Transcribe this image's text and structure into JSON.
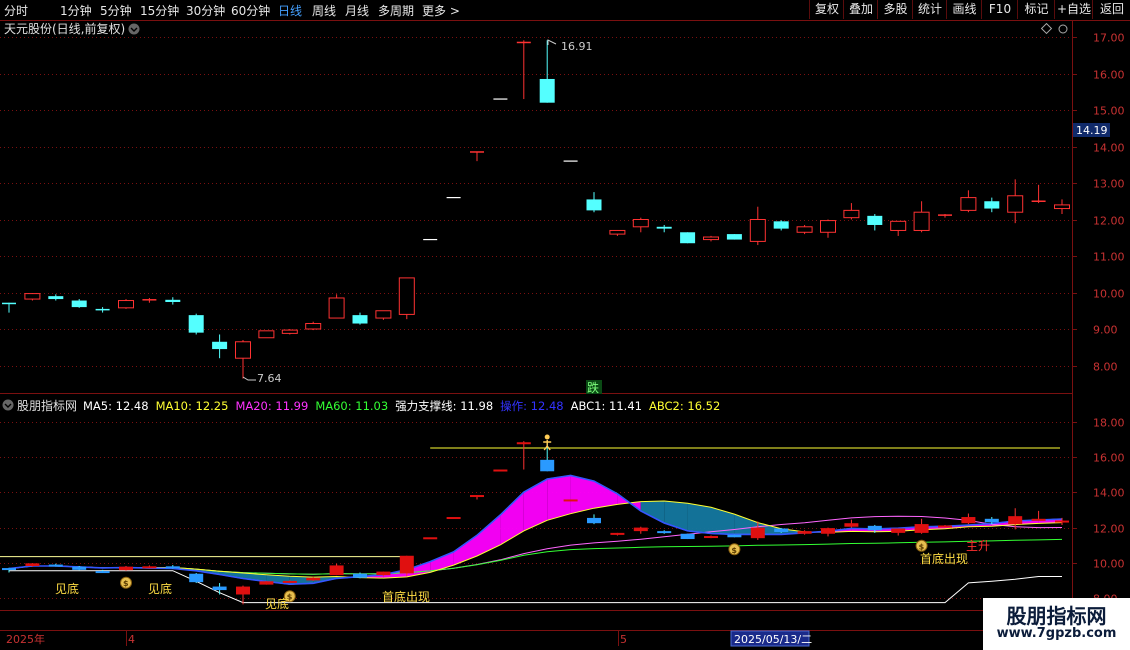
{
  "toolbar": {
    "periods": [
      "分时",
      "1分钟",
      "5分钟",
      "15分钟",
      "30分钟",
      "60分钟",
      "日线",
      "周线",
      "月线",
      "多周期",
      "更多 >"
    ],
    "active_period": "日线",
    "right_buttons": [
      "复权",
      "叠加",
      "多股",
      "统计",
      "画线",
      "F10",
      "标记",
      "+自选",
      "返回"
    ]
  },
  "main_chart": {
    "title": "天元股份(日线,前复权)",
    "y_labels": [
      "17.00",
      "16.00",
      "15.00",
      "14.00",
      "13.00",
      "12.00",
      "11.00",
      "10.00",
      "9.00",
      "8.00"
    ],
    "current_price_tag": "14.19",
    "high_label": "16.91",
    "low_label": "7.64",
    "signal_label": "跌"
  },
  "indicator": {
    "name": "股朋指标网",
    "values": [
      {
        "label": "MA5: 12.48",
        "color": "#ffffff"
      },
      {
        "label": "MA10: 12.25",
        "color": "#ffff33"
      },
      {
        "label": "MA20: 11.99",
        "color": "#ff33ff"
      },
      {
        "label": "MA60: 11.03",
        "color": "#33ff33"
      },
      {
        "label": "强力支撑线: 11.98",
        "color": "#ffffff"
      },
      {
        "label": "操作: 12.48",
        "color": "#3333ff"
      },
      {
        "label": "ABC1: 11.41",
        "color": "#ffffff"
      },
      {
        "label": "ABC2: 16.52",
        "color": "#ffff33"
      }
    ],
    "y_labels": [
      "18.00",
      "16.00",
      "14.00",
      "12.00",
      "10.00",
      "8.00"
    ],
    "annotations": [
      "见底",
      "见底",
      "见底",
      "首底出现",
      "首底出现",
      "主升"
    ]
  },
  "timeline": {
    "labels": [
      "2025年",
      "4",
      "5"
    ],
    "date_box": "2025/05/13/二"
  },
  "watermark": {
    "title": "股朋指标网",
    "url": "www.7gpzb.com"
  },
  "colors": {
    "up": "#ff3232",
    "down": "#54ffff",
    "grid": "#7a1010",
    "axis_text": "#c83232",
    "ribbon_up": "#ff00ff",
    "ribbon_down": "#1478a0"
  },
  "chart_data": {
    "type": "candlestick",
    "ohlc": [
      [
        9.7,
        9.72,
        9.45,
        9.67
      ],
      [
        9.82,
        9.98,
        9.78,
        9.97
      ],
      [
        9.9,
        9.95,
        9.78,
        9.82
      ],
      [
        9.78,
        9.82,
        9.58,
        9.6
      ],
      [
        9.53,
        9.6,
        9.45,
        9.5
      ],
      [
        9.58,
        9.82,
        9.55,
        9.78
      ],
      [
        9.78,
        9.85,
        9.72,
        9.8
      ],
      [
        9.8,
        9.87,
        9.67,
        9.74
      ],
      [
        9.38,
        9.42,
        8.85,
        8.9
      ],
      [
        8.65,
        8.85,
        8.2,
        8.45
      ],
      [
        8.2,
        8.7,
        7.64,
        8.65
      ],
      [
        8.76,
        8.96,
        8.76,
        8.95
      ],
      [
        8.88,
        9.0,
        8.85,
        8.97
      ],
      [
        9.0,
        9.2,
        8.97,
        9.15
      ],
      [
        9.3,
        9.95,
        9.3,
        9.85
      ],
      [
        9.38,
        9.45,
        9.12,
        9.15
      ],
      [
        9.3,
        9.5,
        9.25,
        9.5
      ],
      [
        9.4,
        10.4,
        9.27,
        10.4
      ],
      [
        11.45,
        11.45,
        11.45,
        11.45
      ],
      [
        12.6,
        12.6,
        12.6,
        12.6
      ],
      [
        13.85,
        13.85,
        13.6,
        13.85
      ],
      [
        15.3,
        15.3,
        15.3,
        15.3
      ],
      [
        16.85,
        16.91,
        15.3,
        16.85
      ],
      [
        15.85,
        16.91,
        15.2,
        15.2
      ],
      [
        13.6,
        13.6,
        13.6,
        13.6
      ],
      [
        12.55,
        12.75,
        12.2,
        12.25
      ],
      [
        11.6,
        11.7,
        11.55,
        11.7
      ],
      [
        11.8,
        12.05,
        11.65,
        12.0
      ],
      [
        11.8,
        11.85,
        11.65,
        11.75
      ],
      [
        11.65,
        11.65,
        11.35,
        11.35
      ],
      [
        11.45,
        11.55,
        11.4,
        11.52
      ],
      [
        11.6,
        11.6,
        11.45,
        11.45
      ],
      [
        11.4,
        12.35,
        11.3,
        12.0
      ],
      [
        11.95,
        11.98,
        11.7,
        11.75
      ],
      [
        11.65,
        11.85,
        11.6,
        11.8
      ],
      [
        11.65,
        12.0,
        11.5,
        11.97
      ],
      [
        12.05,
        12.45,
        12.0,
        12.25
      ],
      [
        12.1,
        12.15,
        11.7,
        11.85
      ],
      [
        11.7,
        11.95,
        11.55,
        11.95
      ],
      [
        11.7,
        12.5,
        11.65,
        12.2
      ],
      [
        12.1,
        12.15,
        12.05,
        12.12
      ],
      [
        12.25,
        12.8,
        12.2,
        12.6
      ],
      [
        12.5,
        12.6,
        12.2,
        12.3
      ],
      [
        12.2,
        13.1,
        11.9,
        12.65
      ],
      [
        12.5,
        12.95,
        12.45,
        12.5
      ],
      [
        12.3,
        12.55,
        12.15,
        12.4
      ]
    ]
  }
}
